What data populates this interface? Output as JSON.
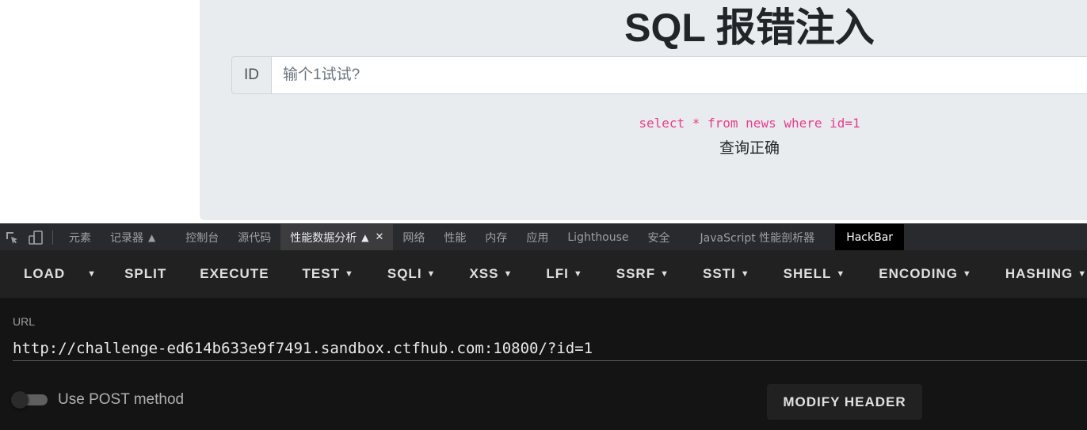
{
  "page": {
    "title": "SQL 报错注入",
    "input_prefix": "ID",
    "input_placeholder": "输个1试试?",
    "sql_query": "select * from news where id=1",
    "result": "查询正确"
  },
  "devtools": {
    "tabs": [
      "元素",
      "记录器",
      "控制台",
      "源代码",
      "性能数据分析",
      "网络",
      "性能",
      "内存",
      "应用",
      "Lighthouse",
      "安全",
      "JavaScript 性能剖析器",
      "HackBar"
    ]
  },
  "hackbar": {
    "toolbar": {
      "load": "LOAD",
      "split": "SPLIT",
      "execute": "EXECUTE",
      "test": "TEST",
      "sqli": "SQLI",
      "xss": "XSS",
      "lfi": "LFI",
      "ssrf": "SSRF",
      "ssti": "SSTI",
      "shell": "SHELL",
      "encoding": "ENCODING",
      "hashing": "HASHING"
    },
    "url_label": "URL",
    "url_value": "http://challenge-ed614b633e9f7491.sandbox.ctfhub.com:10800/?id=1",
    "post_label": "Use POST method",
    "post_enabled": false,
    "modify_header": "MODIFY HEADER"
  }
}
